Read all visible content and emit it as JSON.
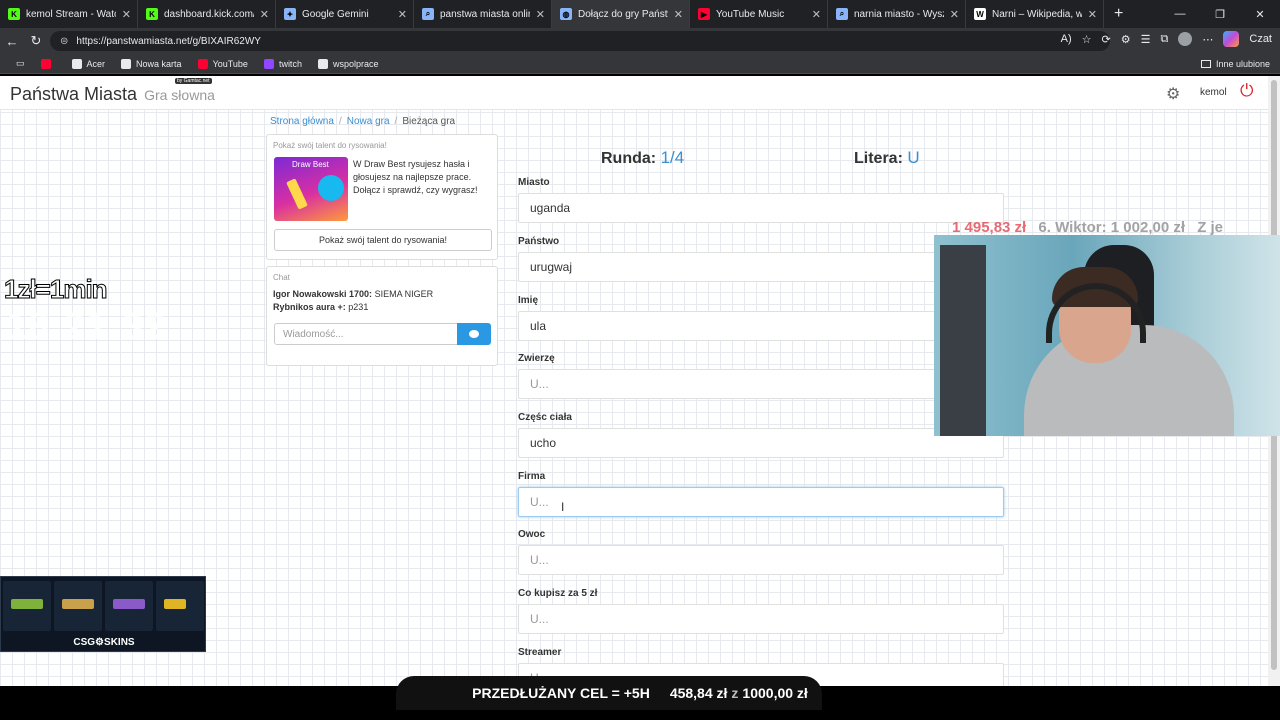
{
  "browser": {
    "tabs": [
      {
        "title": "kemol Stream - Watch Live o",
        "favicon_color": "#53fc18",
        "favicon": "K"
      },
      {
        "title": "dashboard.kick.com/stream",
        "favicon_color": "#53fc18",
        "favicon": "K"
      },
      {
        "title": "Google Gemini",
        "favicon_color": "#8ab4f8",
        "favicon": "✦"
      },
      {
        "title": "panstwa miasta online - Wys",
        "favicon_color": "#8ab4f8",
        "favicon": "⌕"
      },
      {
        "title": "Dołącz do gry Państwa Mias",
        "favicon_color": "#8ab4f8",
        "favicon": "◍",
        "active": true
      },
      {
        "title": "YouTube Music",
        "favicon_color": "#ff0033",
        "favicon": "▶"
      },
      {
        "title": "narnia miasto - Wyszukaj",
        "favicon_color": "#8ab4f8",
        "favicon": "⌕"
      },
      {
        "title": "Narni – Wikipedia, wolna en",
        "favicon_color": "#ffffff",
        "favicon": "W"
      }
    ],
    "url": "https://panstwamiasta.net/g/BIXAIR62WY",
    "copilot_label": "Czat",
    "bookmarks": [
      {
        "label": "",
        "icon": "youtube-icon",
        "color": "#ff0033"
      },
      {
        "label": "Acer",
        "icon": "folder-icon",
        "color": "#e8eaed"
      },
      {
        "label": "Nowa karta",
        "icon": "globe-icon",
        "color": "#e8eaed"
      },
      {
        "label": "YouTube",
        "icon": "youtube-icon",
        "color": "#ff0033"
      },
      {
        "label": "twitch",
        "icon": "twitch-icon",
        "color": "#9146ff"
      },
      {
        "label": "wspolprace",
        "icon": "folder-icon",
        "color": "#e8eaed"
      }
    ],
    "other_bookmarks": "Inne ulubione"
  },
  "site": {
    "brand": "Państwa Miasta",
    "brand_sub": "Gra słowna",
    "brand_tag": "by Gamtac.net",
    "username": "kemol"
  },
  "breadcrumb": {
    "home": "Strona główna",
    "new_game": "Nowa gra",
    "current": "Bieżąca gra"
  },
  "promo": {
    "title": "Pokaż swój talent do rysowania!",
    "image_label": "Draw Best",
    "description": "W Draw Best rysujesz hasła i głosujesz na najlepsze prace. Dołącz i sprawdź, czy wygrasz!",
    "button": "Pokaż swój talent do rysowania!"
  },
  "chat": {
    "title": "Chat",
    "messages": [
      {
        "author": "Igor Nowakowski 1700:",
        "text": "SIEMA NIGER"
      },
      {
        "author": "Rybnikos aura +:",
        "text": "p231"
      }
    ],
    "placeholder": "Wiadomość..."
  },
  "game": {
    "round_label": "Runda:",
    "round_value": "1/4",
    "letter_label": "Litera:",
    "letter_value": "U",
    "fields": [
      {
        "label": "Miasto",
        "value": "uganda",
        "placeholder": ""
      },
      {
        "label": "Państwo",
        "value": "urugwaj",
        "placeholder": ""
      },
      {
        "label": "Imię",
        "value": "ula",
        "placeholder": ""
      },
      {
        "label": "Zwierzę",
        "value": "",
        "placeholder": "U..."
      },
      {
        "label": "Częśc ciała",
        "value": "ucho",
        "placeholder": ""
      },
      {
        "label": "Firma",
        "value": "",
        "placeholder": "U...",
        "focused": true
      },
      {
        "label": "Owoc",
        "value": "",
        "placeholder": "U..."
      },
      {
        "label": "Co kupisz za 5 zł",
        "value": "",
        "placeholder": "U..."
      },
      {
        "label": "Streamer",
        "value": "",
        "placeholder": "U..."
      }
    ]
  },
  "overlay": {
    "rate": "1zł=1min",
    "clock": "18:21:32",
    "goal_left": "1 495,83 zł",
    "goal_person": "6. Wiktor: 1 002,00 zł",
    "goal_right": "Z je",
    "csg_label": "CSG⚙SKINS",
    "goal_title": "PRZEDŁUŻANY CEL = +5H",
    "goal_current": "458,84 zł",
    "goal_sep": "z",
    "goal_target": "1000,00 zł"
  }
}
